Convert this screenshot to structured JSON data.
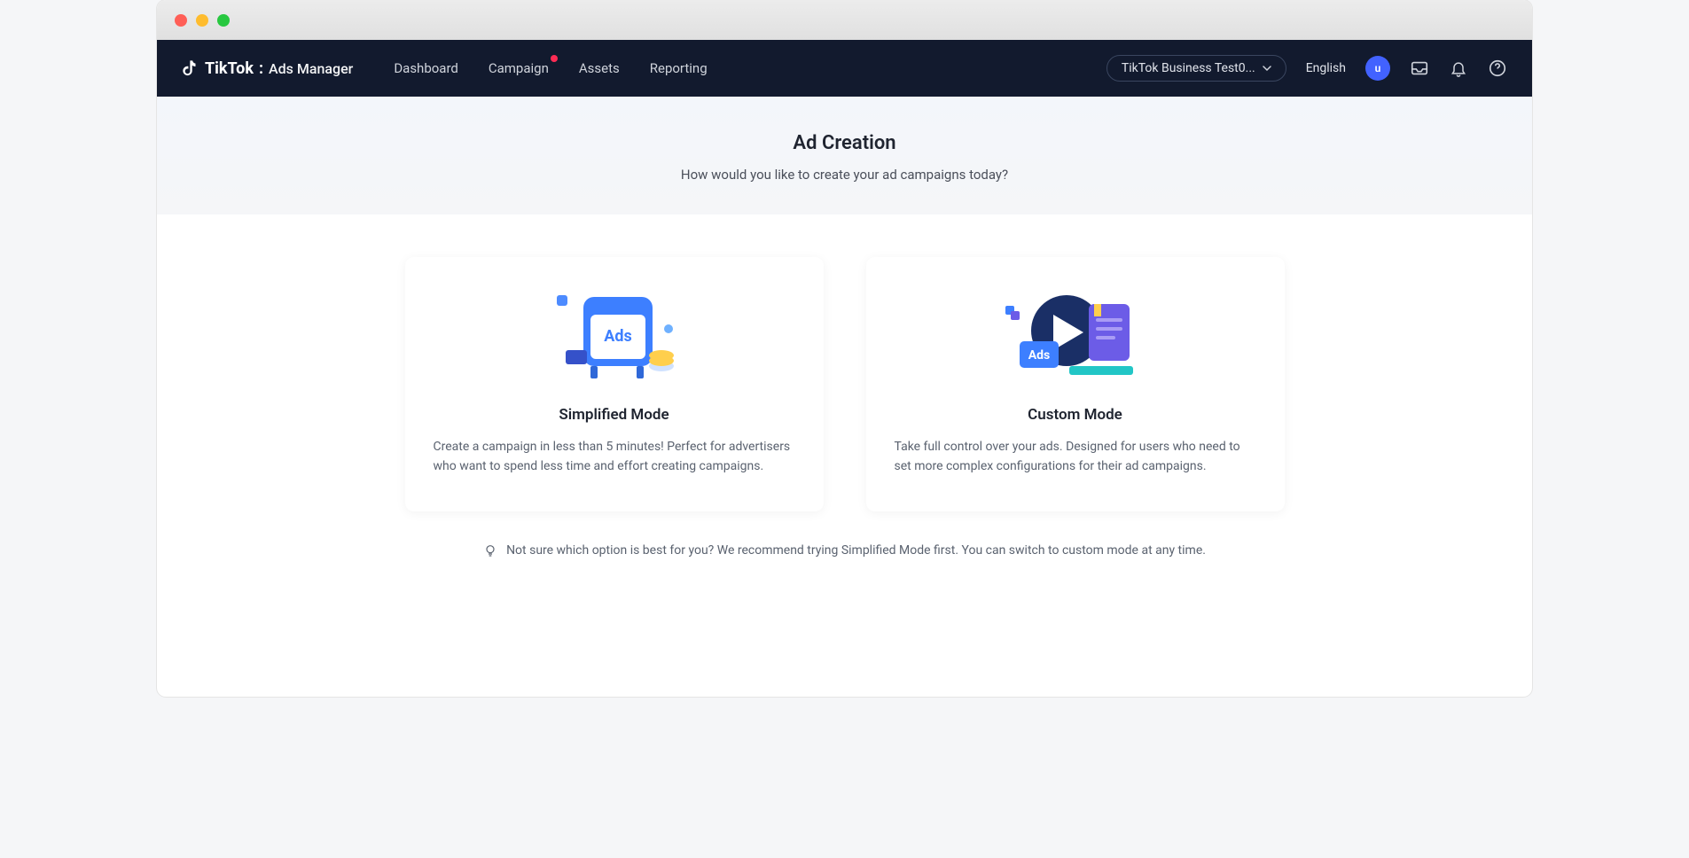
{
  "brand": {
    "name": "TikTok",
    "sep": ":",
    "product": "Ads Manager"
  },
  "nav": {
    "items": [
      {
        "label": "Dashboard"
      },
      {
        "label": "Campaign",
        "has_badge": true
      },
      {
        "label": "Assets"
      },
      {
        "label": "Reporting"
      }
    ]
  },
  "account": {
    "label": "TikTok Business Test0..."
  },
  "language": "English",
  "avatar_initial": "u",
  "hero": {
    "title": "Ad Creation",
    "subtitle": "How would you like to create your ad campaigns today?"
  },
  "cards": [
    {
      "title": "Simplified Mode",
      "desc": "Create a campaign in less than 5 minutes! Perfect for advertisers who want to spend less time and effort creating campaigns."
    },
    {
      "title": "Custom Mode",
      "desc": "Take full control over your ads. Designed for users who need to set more complex configurations for their ad campaigns."
    }
  ],
  "hint": "Not sure which option is best for you? We recommend trying Simplified Mode first. You can switch to custom mode at any time."
}
